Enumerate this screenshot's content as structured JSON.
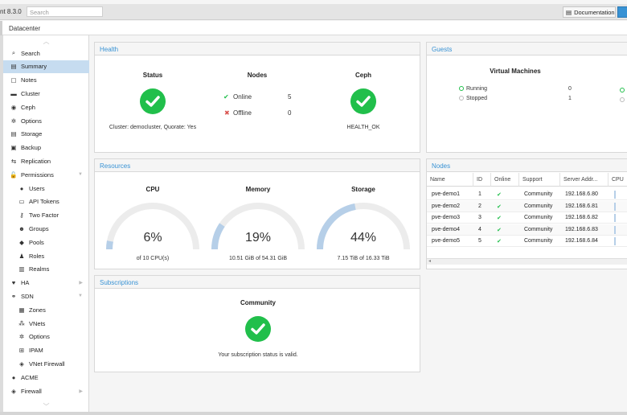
{
  "app": {
    "brand": "nt 8.3.0",
    "search_placeholder": "Search",
    "documentation": "Documentation"
  },
  "breadcrumb": "Datacenter",
  "sidebar": [
    {
      "icon": "search-icon",
      "glyph": "⌕",
      "label": "Search",
      "arrow": ""
    },
    {
      "icon": "summary-icon",
      "glyph": "▤",
      "label": "Summary",
      "arrow": ""
    },
    {
      "icon": "notes-icon",
      "glyph": "▢",
      "label": "Notes",
      "arrow": ""
    },
    {
      "icon": "cluster-icon",
      "glyph": "▬",
      "label": "Cluster",
      "arrow": ""
    },
    {
      "icon": "ceph-icon",
      "glyph": "◉",
      "label": "Ceph",
      "arrow": ""
    },
    {
      "icon": "gear-icon",
      "glyph": "✲",
      "label": "Options",
      "arrow": ""
    },
    {
      "icon": "storage-icon",
      "glyph": "▤",
      "label": "Storage",
      "arrow": ""
    },
    {
      "icon": "backup-icon",
      "glyph": "▣",
      "label": "Backup",
      "arrow": ""
    },
    {
      "icon": "replication-icon",
      "glyph": "⇆",
      "label": "Replication",
      "arrow": ""
    },
    {
      "icon": "unlock-icon",
      "glyph": "🔓",
      "label": "Permissions",
      "arrow": "▼"
    },
    {
      "icon": "user-icon",
      "glyph": "●",
      "label": "Users",
      "arrow": "",
      "indent": true
    },
    {
      "icon": "tag-icon",
      "glyph": "▭",
      "label": "API Tokens",
      "arrow": "",
      "indent": true
    },
    {
      "icon": "key-icon",
      "glyph": "⚷",
      "label": "Two Factor",
      "arrow": "",
      "indent": true
    },
    {
      "icon": "users-icon",
      "glyph": "☻",
      "label": "Groups",
      "arrow": "",
      "indent": true
    },
    {
      "icon": "pools-icon",
      "glyph": "◆",
      "label": "Pools",
      "arrow": "",
      "indent": true
    },
    {
      "icon": "male-icon",
      "glyph": "♟",
      "label": "Roles",
      "arrow": "",
      "indent": true
    },
    {
      "icon": "realms-icon",
      "glyph": "▥",
      "label": "Realms",
      "arrow": "",
      "indent": true
    },
    {
      "icon": "heartbeat-icon",
      "glyph": "♥",
      "label": "HA",
      "arrow": "▶"
    },
    {
      "icon": "sdn-icon",
      "glyph": "⚭",
      "label": "SDN",
      "arrow": "▼"
    },
    {
      "icon": "zones-icon",
      "glyph": "▦",
      "label": "Zones",
      "arrow": "",
      "indent": true
    },
    {
      "icon": "vnets-icon",
      "glyph": "⁂",
      "label": "VNets",
      "arrow": "",
      "indent": true
    },
    {
      "icon": "gear-icon",
      "glyph": "✲",
      "label": "Options",
      "arrow": "",
      "indent": true
    },
    {
      "icon": "ipam-icon",
      "glyph": "⊞",
      "label": "IPAM",
      "arrow": "",
      "indent": true
    },
    {
      "icon": "shield-icon",
      "glyph": "◈",
      "label": "VNet Firewall",
      "arrow": "",
      "indent": true
    },
    {
      "icon": "acme-icon",
      "glyph": "●",
      "label": "ACME",
      "arrow": ""
    },
    {
      "icon": "shield-icon",
      "glyph": "◈",
      "label": "Firewall",
      "arrow": "▶"
    }
  ],
  "health": {
    "title": "Health",
    "status_title": "Status",
    "status_text": "Cluster: democluster, Quorate: Yes",
    "nodes_title": "Nodes",
    "online_label": "Online",
    "online_count": "5",
    "offline_label": "Offline",
    "offline_count": "0",
    "ceph_title": "Ceph",
    "ceph_text": "HEALTH_OK"
  },
  "guests": {
    "title": "Guests",
    "vm_title": "Virtual Machines",
    "running_label": "Running",
    "running_count": "0",
    "stopped_label": "Stopped",
    "stopped_count": "1"
  },
  "resources": {
    "title": "Resources",
    "gauges": [
      {
        "title": "CPU",
        "pct_text": "6%",
        "value": 0.06,
        "sub": "of 10 CPU(s)"
      },
      {
        "title": "Memory",
        "pct_text": "19%",
        "value": 0.19,
        "sub": "10.51 GiB of 54.31 GiB"
      },
      {
        "title": "Storage",
        "pct_text": "44%",
        "value": 0.44,
        "sub": "7.15 TiB of 16.33 TiB"
      }
    ]
  },
  "nodes": {
    "title": "Nodes",
    "columns": [
      "Name",
      "ID",
      "Online",
      "Support",
      "Server Addr...",
      "CPU"
    ],
    "rows": [
      {
        "name": "pve-demo1",
        "id": "1",
        "support": "Community",
        "addr": "192.168.6.80"
      },
      {
        "name": "pve-demo2",
        "id": "2",
        "support": "Community",
        "addr": "192.168.6.81"
      },
      {
        "name": "pve-demo3",
        "id": "3",
        "support": "Community",
        "addr": "192.168.6.82"
      },
      {
        "name": "pve-demo4",
        "id": "4",
        "support": "Community",
        "addr": "192.168.6.83"
      },
      {
        "name": "pve-demo5",
        "id": "5",
        "support": "Community",
        "addr": "192.168.6.84"
      }
    ]
  },
  "subscriptions": {
    "title": "Subscriptions",
    "level": "Community",
    "text": "Your subscription status is valid."
  },
  "colors": {
    "accent": "#3892d4",
    "ok": "#21bf4b",
    "error": "#d9534f",
    "gauge_fill": "#b6cfe8",
    "gauge_track": "#ececec"
  }
}
